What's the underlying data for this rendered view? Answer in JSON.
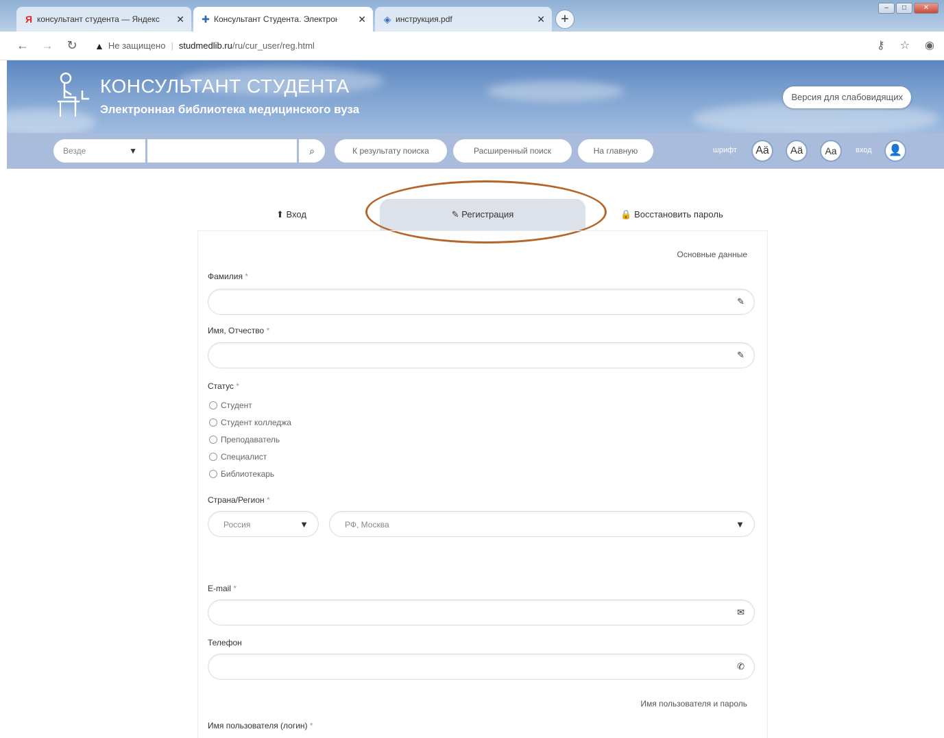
{
  "browser": {
    "tabs": [
      {
        "label": "консультант студента — Яндекс",
        "icon": "yandex-icon",
        "active": false
      },
      {
        "label": "Консультант Студента. Электронная",
        "icon": "site-favicon-icon",
        "active": true
      },
      {
        "label": "инструкция.pdf",
        "icon": "pdf-icon",
        "active": false
      }
    ],
    "new_tab": "+",
    "security": "Не защищено",
    "url_host": "studmedlib.ru",
    "url_path": "/ru/cur_user/reg.html"
  },
  "site": {
    "title": "КОНСУЛЬТАНТ СТУДЕНТА",
    "subtitle": "Электронная библиотека медицинского вуза",
    "low_vision": "Версия для слабовидящих",
    "search": {
      "scope": "Везде",
      "placeholder": "",
      "to_results": "К результату поиска",
      "advanced": "Расширенный поиск",
      "home": "На главную",
      "font_label": "шрифт",
      "font_buttons": [
        "Aä",
        "Aä",
        "Aa"
      ],
      "login_label": "вход"
    }
  },
  "form_tabs": {
    "login": "Вход",
    "register": "Регистрация",
    "restore": "Восстановить пароль"
  },
  "form": {
    "section_main": "Основные данные",
    "surname_label": "Фамилия",
    "name_label": "Имя, Отчество",
    "status_label": "Статус",
    "status_options": [
      "Студент",
      "Студент колледжа",
      "Преподаватель",
      "Специалист",
      "Библиотекарь"
    ],
    "country_label": "Страна/Регион",
    "country_value": "Россия",
    "region_value": "РФ, Москва",
    "email_label": "E-mail",
    "phone_label": "Телефон",
    "section_credentials": "Имя пользователя и пароль",
    "username_label": "Имя пользователя (логин)",
    "required_mark": "*"
  },
  "colors": {
    "header_blue": "#5b86c0",
    "search_bar": "#a9bcdc",
    "active_tab": "#dde2ea",
    "highlight": "#b5652a"
  }
}
